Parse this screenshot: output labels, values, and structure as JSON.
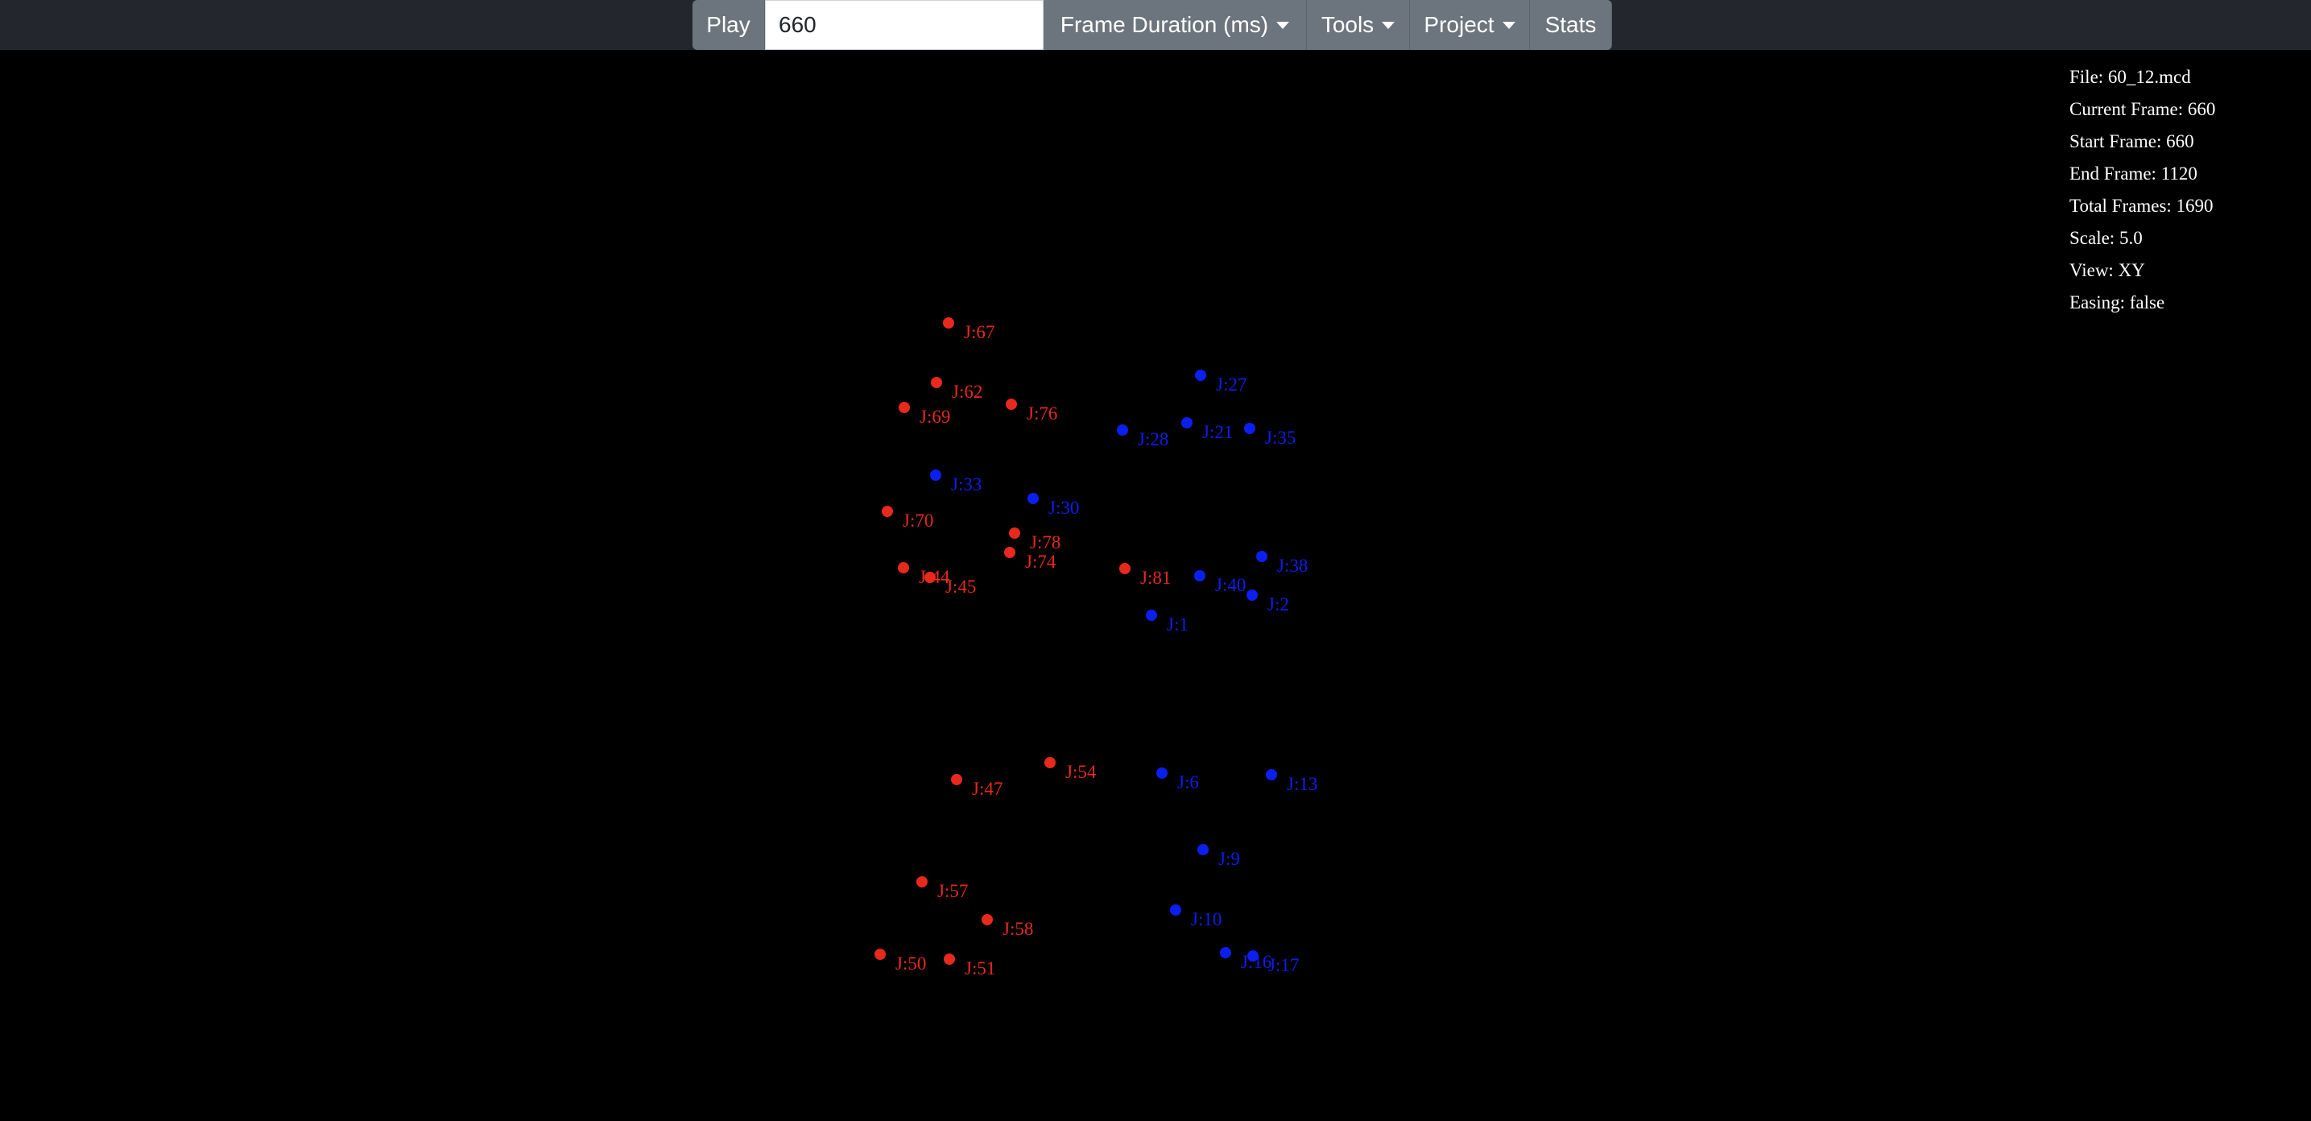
{
  "toolbar": {
    "play_label": "Play",
    "frame_value": "660",
    "frame_duration_label": "Frame Duration (ms)",
    "tools_label": "Tools",
    "project_label": "Project",
    "stats_label": "Stats"
  },
  "info": {
    "file": "File: 60_12.mcd",
    "current_frame": "Current Frame: 660",
    "start_frame": "Start Frame: 660",
    "end_frame": "End Frame: 1120",
    "total_frames": "Total Frames: 1690",
    "scale": "Scale: 5.0",
    "view": "View: XY",
    "easing": "Easing: false"
  },
  "colors": {
    "red": "#e8291c",
    "blue": "#0a1ff0",
    "toolbar_bg": "#23272d",
    "button_bg": "#6c757d"
  },
  "joints": [
    {
      "label": "J:67",
      "color": "red"
    },
    {
      "label": "J:62",
      "color": "red"
    },
    {
      "label": "J:69",
      "color": "red"
    },
    {
      "label": "J:76",
      "color": "red"
    },
    {
      "label": "J:27",
      "color": "blue"
    },
    {
      "label": "J:28",
      "color": "blue"
    },
    {
      "label": "J:21",
      "color": "blue"
    },
    {
      "label": "J:35",
      "color": "blue"
    },
    {
      "label": "J:33",
      "color": "blue"
    },
    {
      "label": "J:30",
      "color": "blue"
    },
    {
      "label": "J:70",
      "color": "red"
    },
    {
      "label": "J:78",
      "color": "red"
    },
    {
      "label": "J:74",
      "color": "red"
    },
    {
      "label": "J:44",
      "color": "red"
    },
    {
      "label": "J:45",
      "color": "red"
    },
    {
      "label": "J:81",
      "color": "red"
    },
    {
      "label": "J:38",
      "color": "blue"
    },
    {
      "label": "J:40",
      "color": "blue"
    },
    {
      "label": "J:2",
      "color": "blue"
    },
    {
      "label": "J:1",
      "color": "blue"
    },
    {
      "label": "J:54",
      "color": "red"
    },
    {
      "label": "J:47",
      "color": "red"
    },
    {
      "label": "J:6",
      "color": "blue"
    },
    {
      "label": "J:13",
      "color": "blue"
    },
    {
      "label": "J:9",
      "color": "blue"
    },
    {
      "label": "J:57",
      "color": "red"
    },
    {
      "label": "J:58",
      "color": "red"
    },
    {
      "label": "J:10",
      "color": "blue"
    },
    {
      "label": "J:50",
      "color": "red"
    },
    {
      "label": "J:51",
      "color": "red"
    },
    {
      "label": "J:16",
      "color": "blue"
    },
    {
      "label": "J:17",
      "color": "blue"
    }
  ]
}
